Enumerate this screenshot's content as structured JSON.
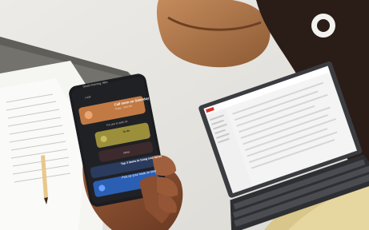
{
  "phone": {
    "header": "Good morning, Alex",
    "subheader": "Look",
    "card1": {
      "title": "Call mom on Saturday",
      "subtitle": "Today · 9:00 AM"
    },
    "section_label": "For you to work on",
    "card2": {
      "title": "To do"
    },
    "card3": {
      "title": "Ideas"
    },
    "card4": {
      "title": "Tap 3 items to bring into focus"
    },
    "card5": {
      "title": "Pick up your book on time"
    }
  },
  "colors": {
    "desk": "#e9e7e3",
    "phone_body": "#1b1c20",
    "card_orange": "#c27a45",
    "card_olive": "#9c8f3c",
    "card_dark_red": "#3d2a2c",
    "card_blue": "#2b5fb3",
    "laptop_body": "#3a3c40",
    "laptop_screen": "#f4f4f4",
    "accent_red": "#d93025"
  }
}
